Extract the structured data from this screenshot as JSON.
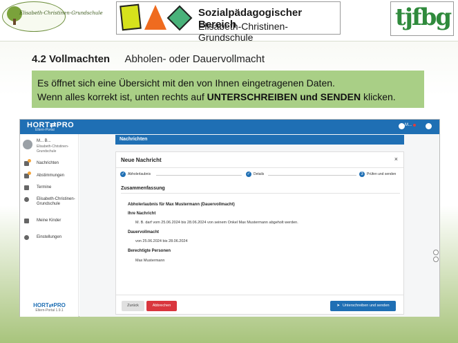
{
  "slide": {
    "logo_left_text": "Elisabeth-Christinen-Grundschule",
    "logo_center_title": "Sozialpädagogischer Bereich",
    "logo_center_subtitle": "Elisabeth-Christinen-Grundschule",
    "logo_right_text": "tjfbg",
    "section_number": "4.2 Vollmachten",
    "section_subtitle": "Abholen- oder Dauervollmacht",
    "info_line1": "Es öffnet sich eine Übersicht mit den von Ihnen eingetragenen Daten.",
    "info_line2_prefix": "Wenn alles korrekt ist, unten rechts auf ",
    "info_line2_bold": "UNTERSCHREIBEN und SENDEN",
    "info_line2_suffix": " klicken."
  },
  "app": {
    "brand": "HORT⇄PRO",
    "brand_sub": "Eltern-Portal",
    "user_short": "M...",
    "sidebar": {
      "user_name": "M... B...",
      "user_school": "Elisabeth-Christinen-Grundschule",
      "items": [
        {
          "label": "Nachrichten",
          "icon": "mail-icon"
        },
        {
          "label": "Abstimmungen",
          "icon": "vote-icon"
        },
        {
          "label": "Termine",
          "icon": "calendar-icon"
        },
        {
          "label": "Elisabeth-Christinen-Grundschule",
          "icon": "info-icon"
        },
        {
          "label": "Meine Kinder",
          "icon": "people-icon"
        },
        {
          "label": "Einstellungen",
          "icon": "gear-icon"
        }
      ],
      "footer_brand": "HORT⇄PRO",
      "footer_version": "Eltern-Portal 1.9.1"
    },
    "tab_title": "Nachrichten",
    "modal": {
      "title": "Neue Nachricht",
      "close": "×",
      "steps": [
        {
          "num": "✓",
          "label": "Abholerlaubnis"
        },
        {
          "num": "✓",
          "label": "Details"
        },
        {
          "num": "3",
          "label": "Prüfen und senden"
        }
      ],
      "summary_heading": "Zusammenfassung",
      "subject": "Abholerlaubnis für Max Mustermann (Dauervollmacht)",
      "message_heading": "Ihre Nachricht",
      "message_text": "M. B. darf vom 25.06.2024 bis 28.06.2024 von seinem Onkel Max Mustermann abgeholt werden.",
      "permission_heading": "Dauervollmacht",
      "permission_text": "von 25.06.2024 bis 28.06.2024",
      "persons_heading": "Berechtigte Personen",
      "persons_text": "Max Mustermann",
      "btn_back": "Zurück",
      "btn_cancel": "Abbrechen",
      "btn_send": "Unterschreiben und senden"
    }
  }
}
